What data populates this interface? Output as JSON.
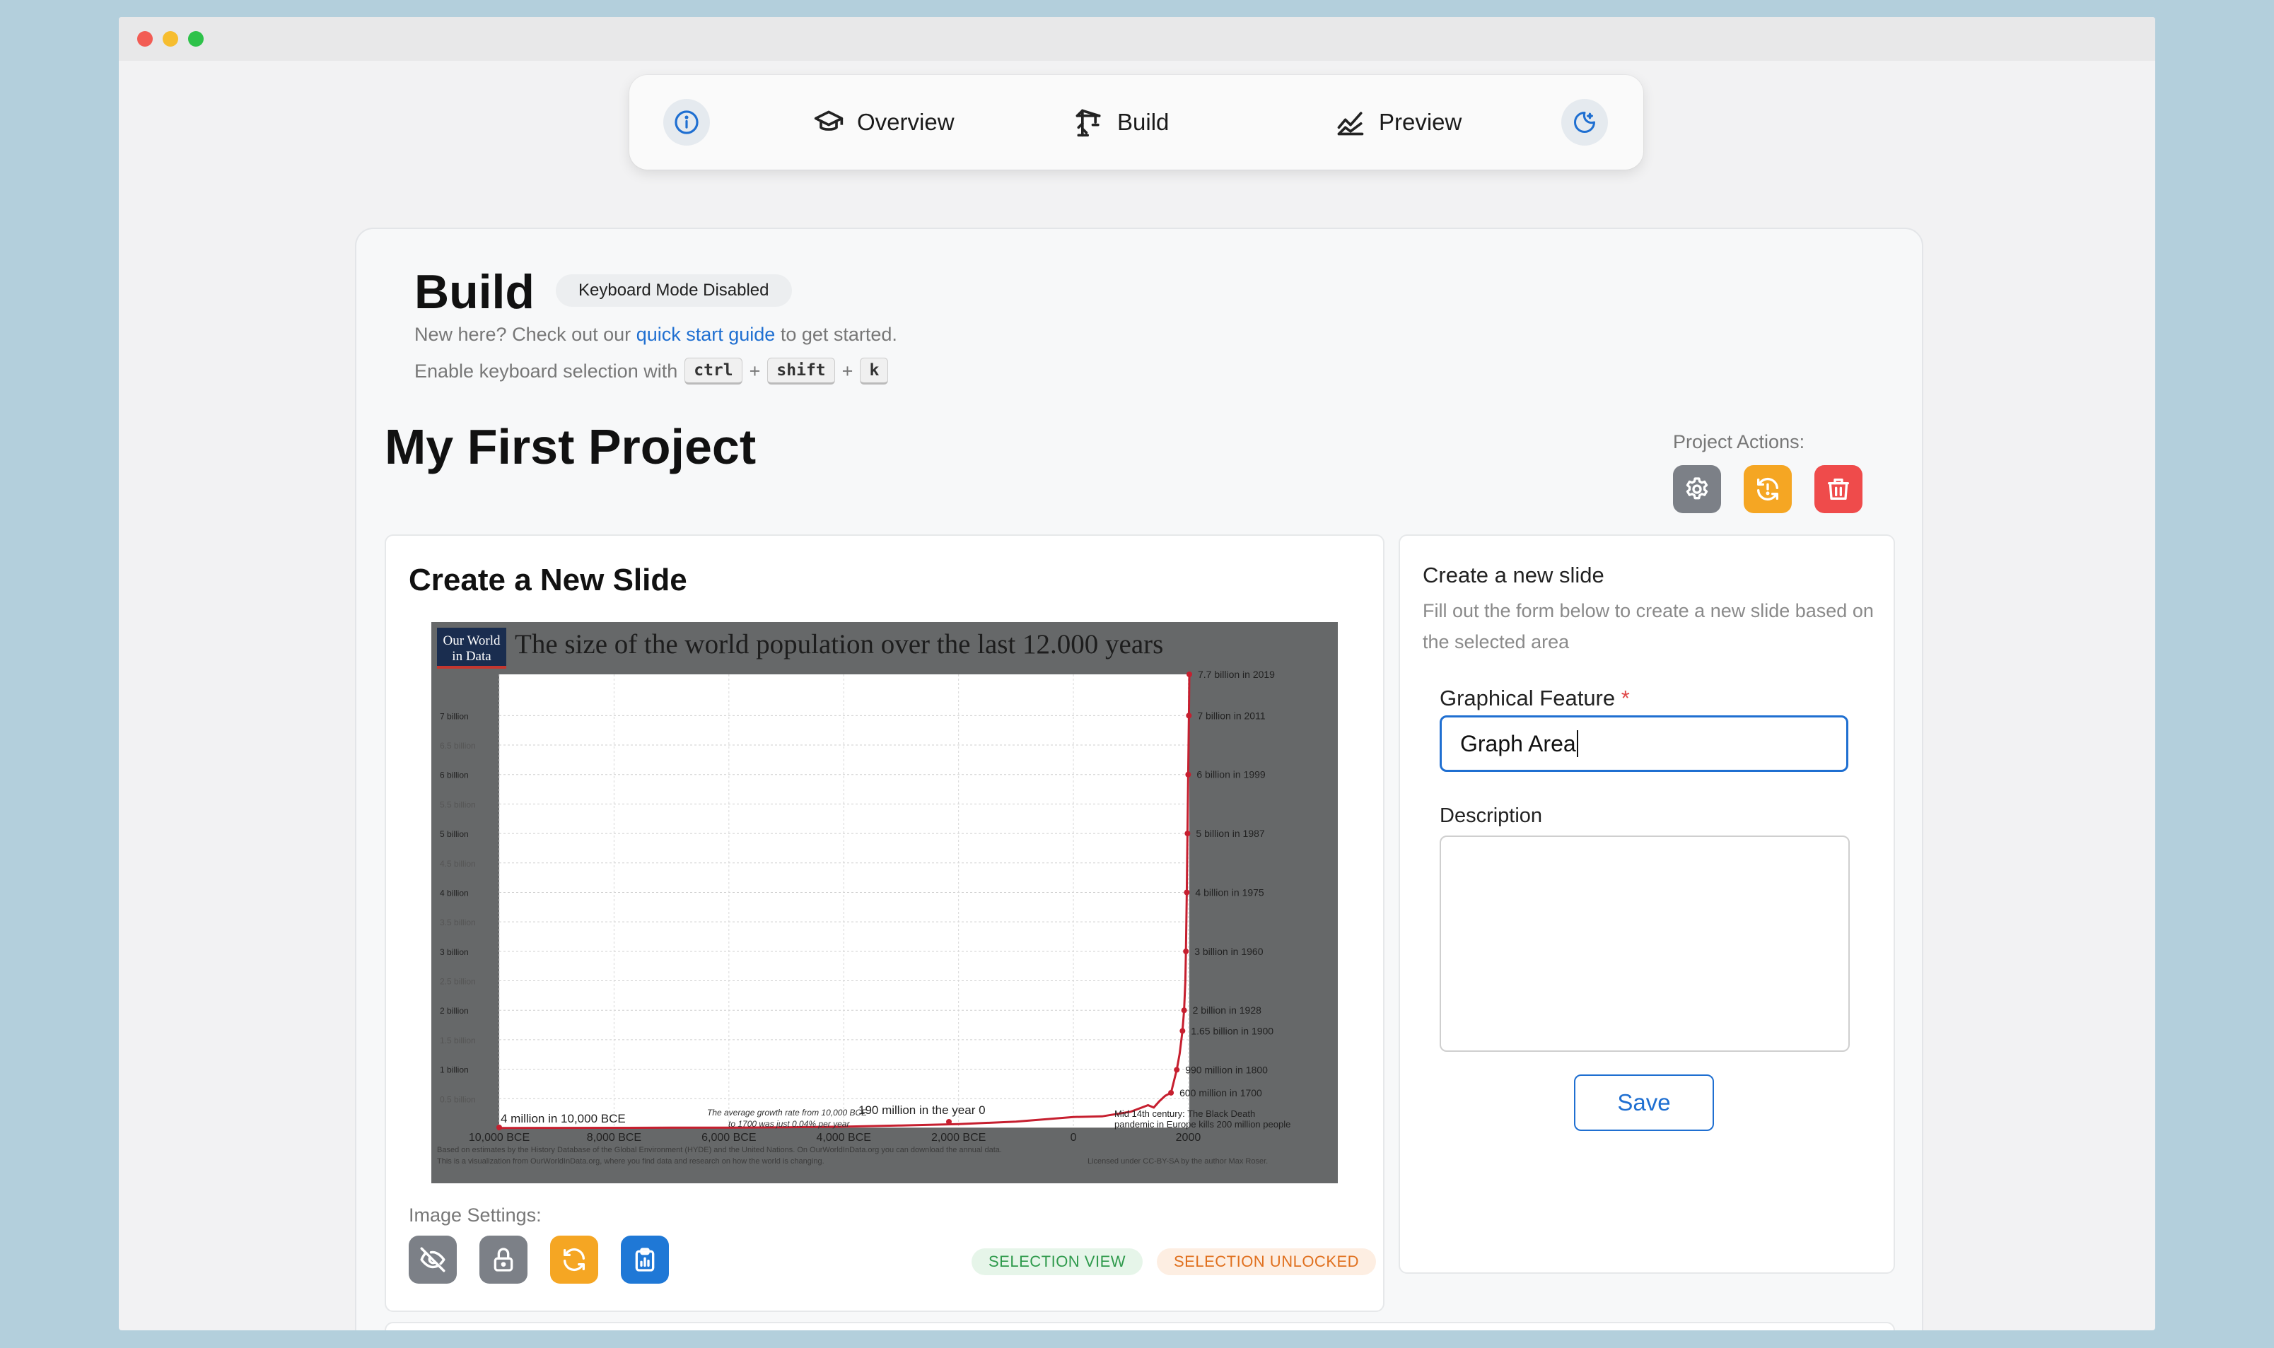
{
  "nav": {
    "overview": "Overview",
    "build": "Build",
    "preview": "Preview"
  },
  "header": {
    "title": "Build",
    "keyboard_badge": "Keyboard Mode Disabled",
    "help_prefix": "New here? Check out our",
    "help_link": "quick start guide",
    "help_suffix": "to get started.",
    "kbd_text": "Enable keyboard selection with",
    "keys": [
      "ctrl",
      "shift",
      "k"
    ],
    "plus": "+"
  },
  "project": {
    "title": "My First Project",
    "actions_label": "Project Actions:"
  },
  "slide": {
    "title": "Create a New Slide",
    "image_settings_label": "Image Settings:",
    "pill_view": "SELECTION VIEW",
    "pill_lock": "SELECTION UNLOCKED"
  },
  "form": {
    "title": "Create a new slide",
    "subtitle": "Fill out the form below to create a new slide based on the selected area",
    "feature_label": "Graphical Feature",
    "required_mark": "*",
    "feature_value": "Graph Area",
    "description_label": "Description",
    "save_label": "Save"
  },
  "colors": {
    "accent": "#1f6fd1",
    "gray_button": "#7c8087",
    "orange_button": "#f5a623",
    "red_button": "#ef4b4b"
  },
  "chart_data": {
    "type": "line",
    "title": "The size of the world population over the last 12.000 years",
    "logo": [
      "Our World",
      "in Data"
    ],
    "y_ticks": [
      "7 billion",
      "6.5 billion",
      "6 billion",
      "5.5 billion",
      "5 billion",
      "4.5 billion",
      "4 billion",
      "3.5 billion",
      "3 billion",
      "2.5 billion",
      "2 billion",
      "1.5 billion",
      "1 billion",
      "0.5 billion"
    ],
    "x_ticks": [
      "10,000 BCE",
      "8,000 BCE",
      "6,000 BCE",
      "4,000 BCE",
      "2,000 BCE",
      "0",
      "2000"
    ],
    "ylim": [
      0,
      7.7
    ],
    "x": [
      -10000,
      -9000,
      -8000,
      -7000,
      -6000,
      -5000,
      -4000,
      -3000,
      -2000,
      -1000,
      0,
      500,
      1000,
      1300,
      1400,
      1500,
      1600,
      1700,
      1800,
      1850,
      1900,
      1928,
      1950,
      1960,
      1975,
      1987,
      1999,
      2011,
      2019
    ],
    "y": [
      0.004,
      0.005,
      0.006,
      0.008,
      0.01,
      0.015,
      0.025,
      0.045,
      0.07,
      0.11,
      0.19,
      0.2,
      0.28,
      0.39,
      0.35,
      0.46,
      0.55,
      0.6,
      0.99,
      1.26,
      1.65,
      2.0,
      2.5,
      3.0,
      4.0,
      5.0,
      6.0,
      7.0,
      7.7
    ],
    "point_labels": [
      {
        "x": 2019,
        "y": 7.7,
        "text": "7.7 billion in 2019"
      },
      {
        "x": 2011,
        "y": 7.0,
        "text": "7 billion in 2011"
      },
      {
        "x": 1999,
        "y": 6.0,
        "text": "6 billion in 1999"
      },
      {
        "x": 1987,
        "y": 5.0,
        "text": "5 billion in 1987"
      },
      {
        "x": 1975,
        "y": 4.0,
        "text": "4 billion in 1975"
      },
      {
        "x": 1960,
        "y": 3.0,
        "text": "3 billion in 1960"
      },
      {
        "x": 1928,
        "y": 2.0,
        "text": "2 billion in 1928"
      },
      {
        "x": 1900,
        "y": 1.65,
        "text": "1.65 billion in 1900"
      },
      {
        "x": 1800,
        "y": 0.99,
        "text": "990 million in 1800"
      },
      {
        "x": 1700,
        "y": 0.6,
        "text": "600 million in 1700"
      }
    ],
    "annotations": {
      "start": "4 million in 10,000 BCE",
      "growth_1": "The average growth rate from 10,000 BCE",
      "growth_2": "to 1700 was just 0.04% per year",
      "year0": "190 million in the year 0",
      "plague_1": "Mid 14th century: The Black Death",
      "plague_2": "pandemic in Europe kills 200 million people"
    },
    "footer": [
      "Based on estimates by the History Database of the Global Environment (HYDE) and the United Nations. On OurWorldInData.org you can download the annual data.",
      "This is a visualization from OurWorldInData.org, where you find data and research on how the world is changing."
    ],
    "license": "Licensed under CC-BY-SA by the author Max Roser."
  }
}
